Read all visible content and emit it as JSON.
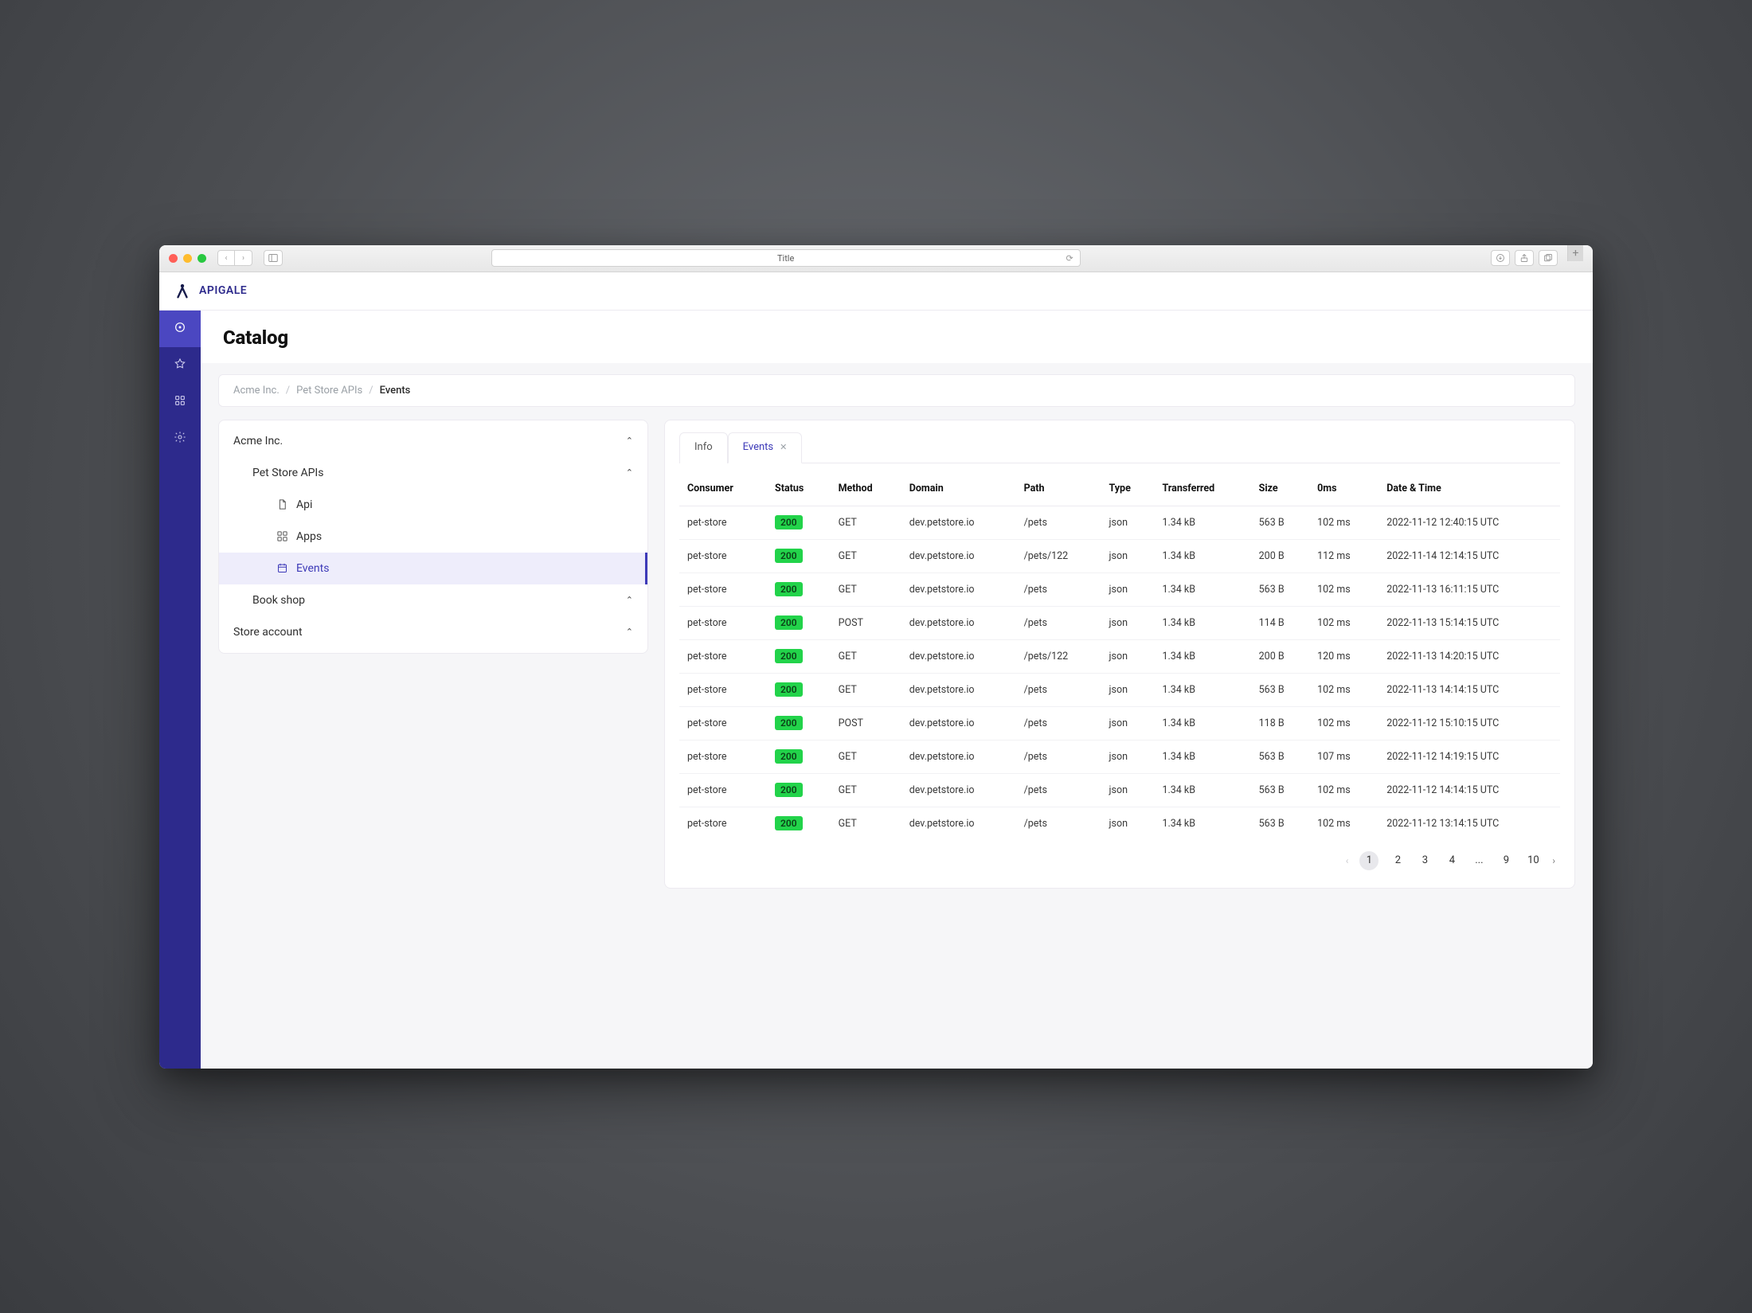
{
  "browser": {
    "url_title": "Title"
  },
  "brand": "APIGALE",
  "page_title": "Catalog",
  "breadcrumb": [
    "Acme Inc.",
    "Pet Store APIs",
    "Events"
  ],
  "tree": {
    "root": "Acme Inc.",
    "group": "Pet Store APIs",
    "items": [
      {
        "icon": "file-icon",
        "label": "Api"
      },
      {
        "icon": "apps-icon",
        "label": "Apps"
      },
      {
        "icon": "calendar-icon",
        "label": "Events",
        "selected": true
      }
    ],
    "siblings": [
      "Book shop",
      "Store account"
    ]
  },
  "tabs": {
    "info": "Info",
    "events": "Events"
  },
  "table": {
    "headers": [
      "Consumer",
      "Status",
      "Method",
      "Domain",
      "Path",
      "Type",
      "Transferred",
      "Size",
      "0ms",
      "Date & Time"
    ],
    "rows": [
      {
        "consumer": "pet-store",
        "status": "200",
        "method": "GET",
        "domain": "dev.petstore.io",
        "path": "/pets",
        "type": "json",
        "transferred": "1.34 kB",
        "size": "563 B",
        "ms": "102 ms",
        "dt": "2022-11-12 12:40:15 UTC"
      },
      {
        "consumer": "pet-store",
        "status": "200",
        "method": "GET",
        "domain": "dev.petstore.io",
        "path": "/pets/122",
        "type": "json",
        "transferred": "1.34 kB",
        "size": "200 B",
        "ms": "112 ms",
        "dt": "2022-11-14 12:14:15 UTC"
      },
      {
        "consumer": "pet-store",
        "status": "200",
        "method": "GET",
        "domain": "dev.petstore.io",
        "path": "/pets",
        "type": "json",
        "transferred": "1.34 kB",
        "size": "563 B",
        "ms": "102 ms",
        "dt": "2022-11-13 16:11:15 UTC"
      },
      {
        "consumer": "pet-store",
        "status": "200",
        "method": "POST",
        "domain": "dev.petstore.io",
        "path": "/pets",
        "type": "json",
        "transferred": "1.34 kB",
        "size": "114 B",
        "ms": "102 ms",
        "dt": "2022-11-13 15:14:15 UTC"
      },
      {
        "consumer": "pet-store",
        "status": "200",
        "method": "GET",
        "domain": "dev.petstore.io",
        "path": "/pets/122",
        "type": "json",
        "transferred": "1.34 kB",
        "size": "200 B",
        "ms": "120 ms",
        "dt": "2022-11-13 14:20:15 UTC"
      },
      {
        "consumer": "pet-store",
        "status": "200",
        "method": "GET",
        "domain": "dev.petstore.io",
        "path": "/pets",
        "type": "json",
        "transferred": "1.34 kB",
        "size": "563 B",
        "ms": "102 ms",
        "dt": "2022-11-13 14:14:15 UTC"
      },
      {
        "consumer": "pet-store",
        "status": "200",
        "method": "POST",
        "domain": "dev.petstore.io",
        "path": "/pets",
        "type": "json",
        "transferred": "1.34 kB",
        "size": "118 B",
        "ms": "102 ms",
        "dt": "2022-11-12 15:10:15 UTC"
      },
      {
        "consumer": "pet-store",
        "status": "200",
        "method": "GET",
        "domain": "dev.petstore.io",
        "path": "/pets",
        "type": "json",
        "transferred": "1.34 kB",
        "size": "563 B",
        "ms": "107 ms",
        "dt": "2022-11-12 14:19:15 UTC"
      },
      {
        "consumer": "pet-store",
        "status": "200",
        "method": "GET",
        "domain": "dev.petstore.io",
        "path": "/pets",
        "type": "json",
        "transferred": "1.34 kB",
        "size": "563 B",
        "ms": "102 ms",
        "dt": "2022-11-12 14:14:15 UTC"
      },
      {
        "consumer": "pet-store",
        "status": "200",
        "method": "GET",
        "domain": "dev.petstore.io",
        "path": "/pets",
        "type": "json",
        "transferred": "1.34 kB",
        "size": "563 B",
        "ms": "102 ms",
        "dt": "2022-11-12 13:14:15 UTC"
      }
    ]
  },
  "pagination": {
    "pages": [
      "1",
      "2",
      "3",
      "4",
      "...",
      "9",
      "10"
    ],
    "current": "1"
  }
}
